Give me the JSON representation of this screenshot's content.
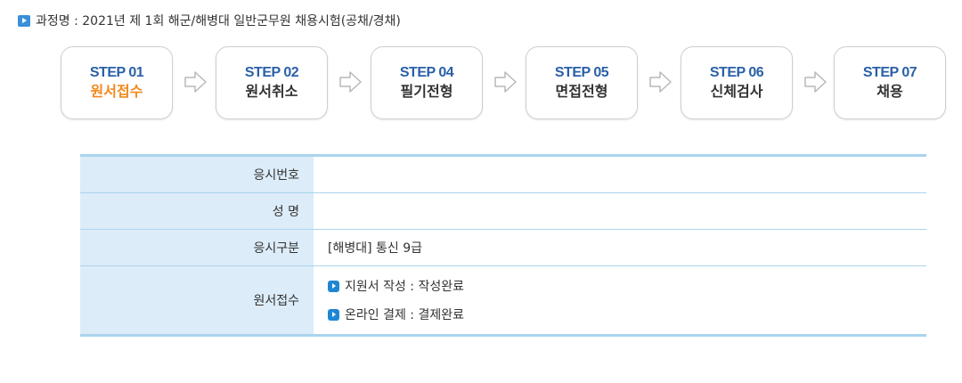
{
  "course": {
    "text": "과정명 : 2021년 제 1회 해군/해병대 일반군무원 채용시험(공채/경채)"
  },
  "steps": [
    {
      "num": "STEP 01",
      "name": "원서접수",
      "active": true
    },
    {
      "num": "STEP 02",
      "name": "원서취소",
      "active": false
    },
    {
      "num": "STEP 04",
      "name": "필기전형",
      "active": false
    },
    {
      "num": "STEP 05",
      "name": "면접전형",
      "active": false
    },
    {
      "num": "STEP 06",
      "name": "신체검사",
      "active": false
    },
    {
      "num": "STEP 07",
      "name": "채용",
      "active": false
    }
  ],
  "info": {
    "exam_number_label": "응시번호",
    "exam_number_value": "",
    "name_label": "성 명",
    "name_value": "",
    "category_label": "응시구분",
    "category_value": "[해병대] 통신 9급",
    "application_label": "원서접수",
    "status_lines": [
      "지원서 작성 : 작성완료",
      "온라인 결제 : 결제완료"
    ]
  },
  "colors": {
    "active_step": "#f28a1e",
    "step_number": "#2a60a8",
    "table_header_bg": "#dcecf8",
    "table_border": "#a9d4ee",
    "bullet": "#1f86d4"
  }
}
